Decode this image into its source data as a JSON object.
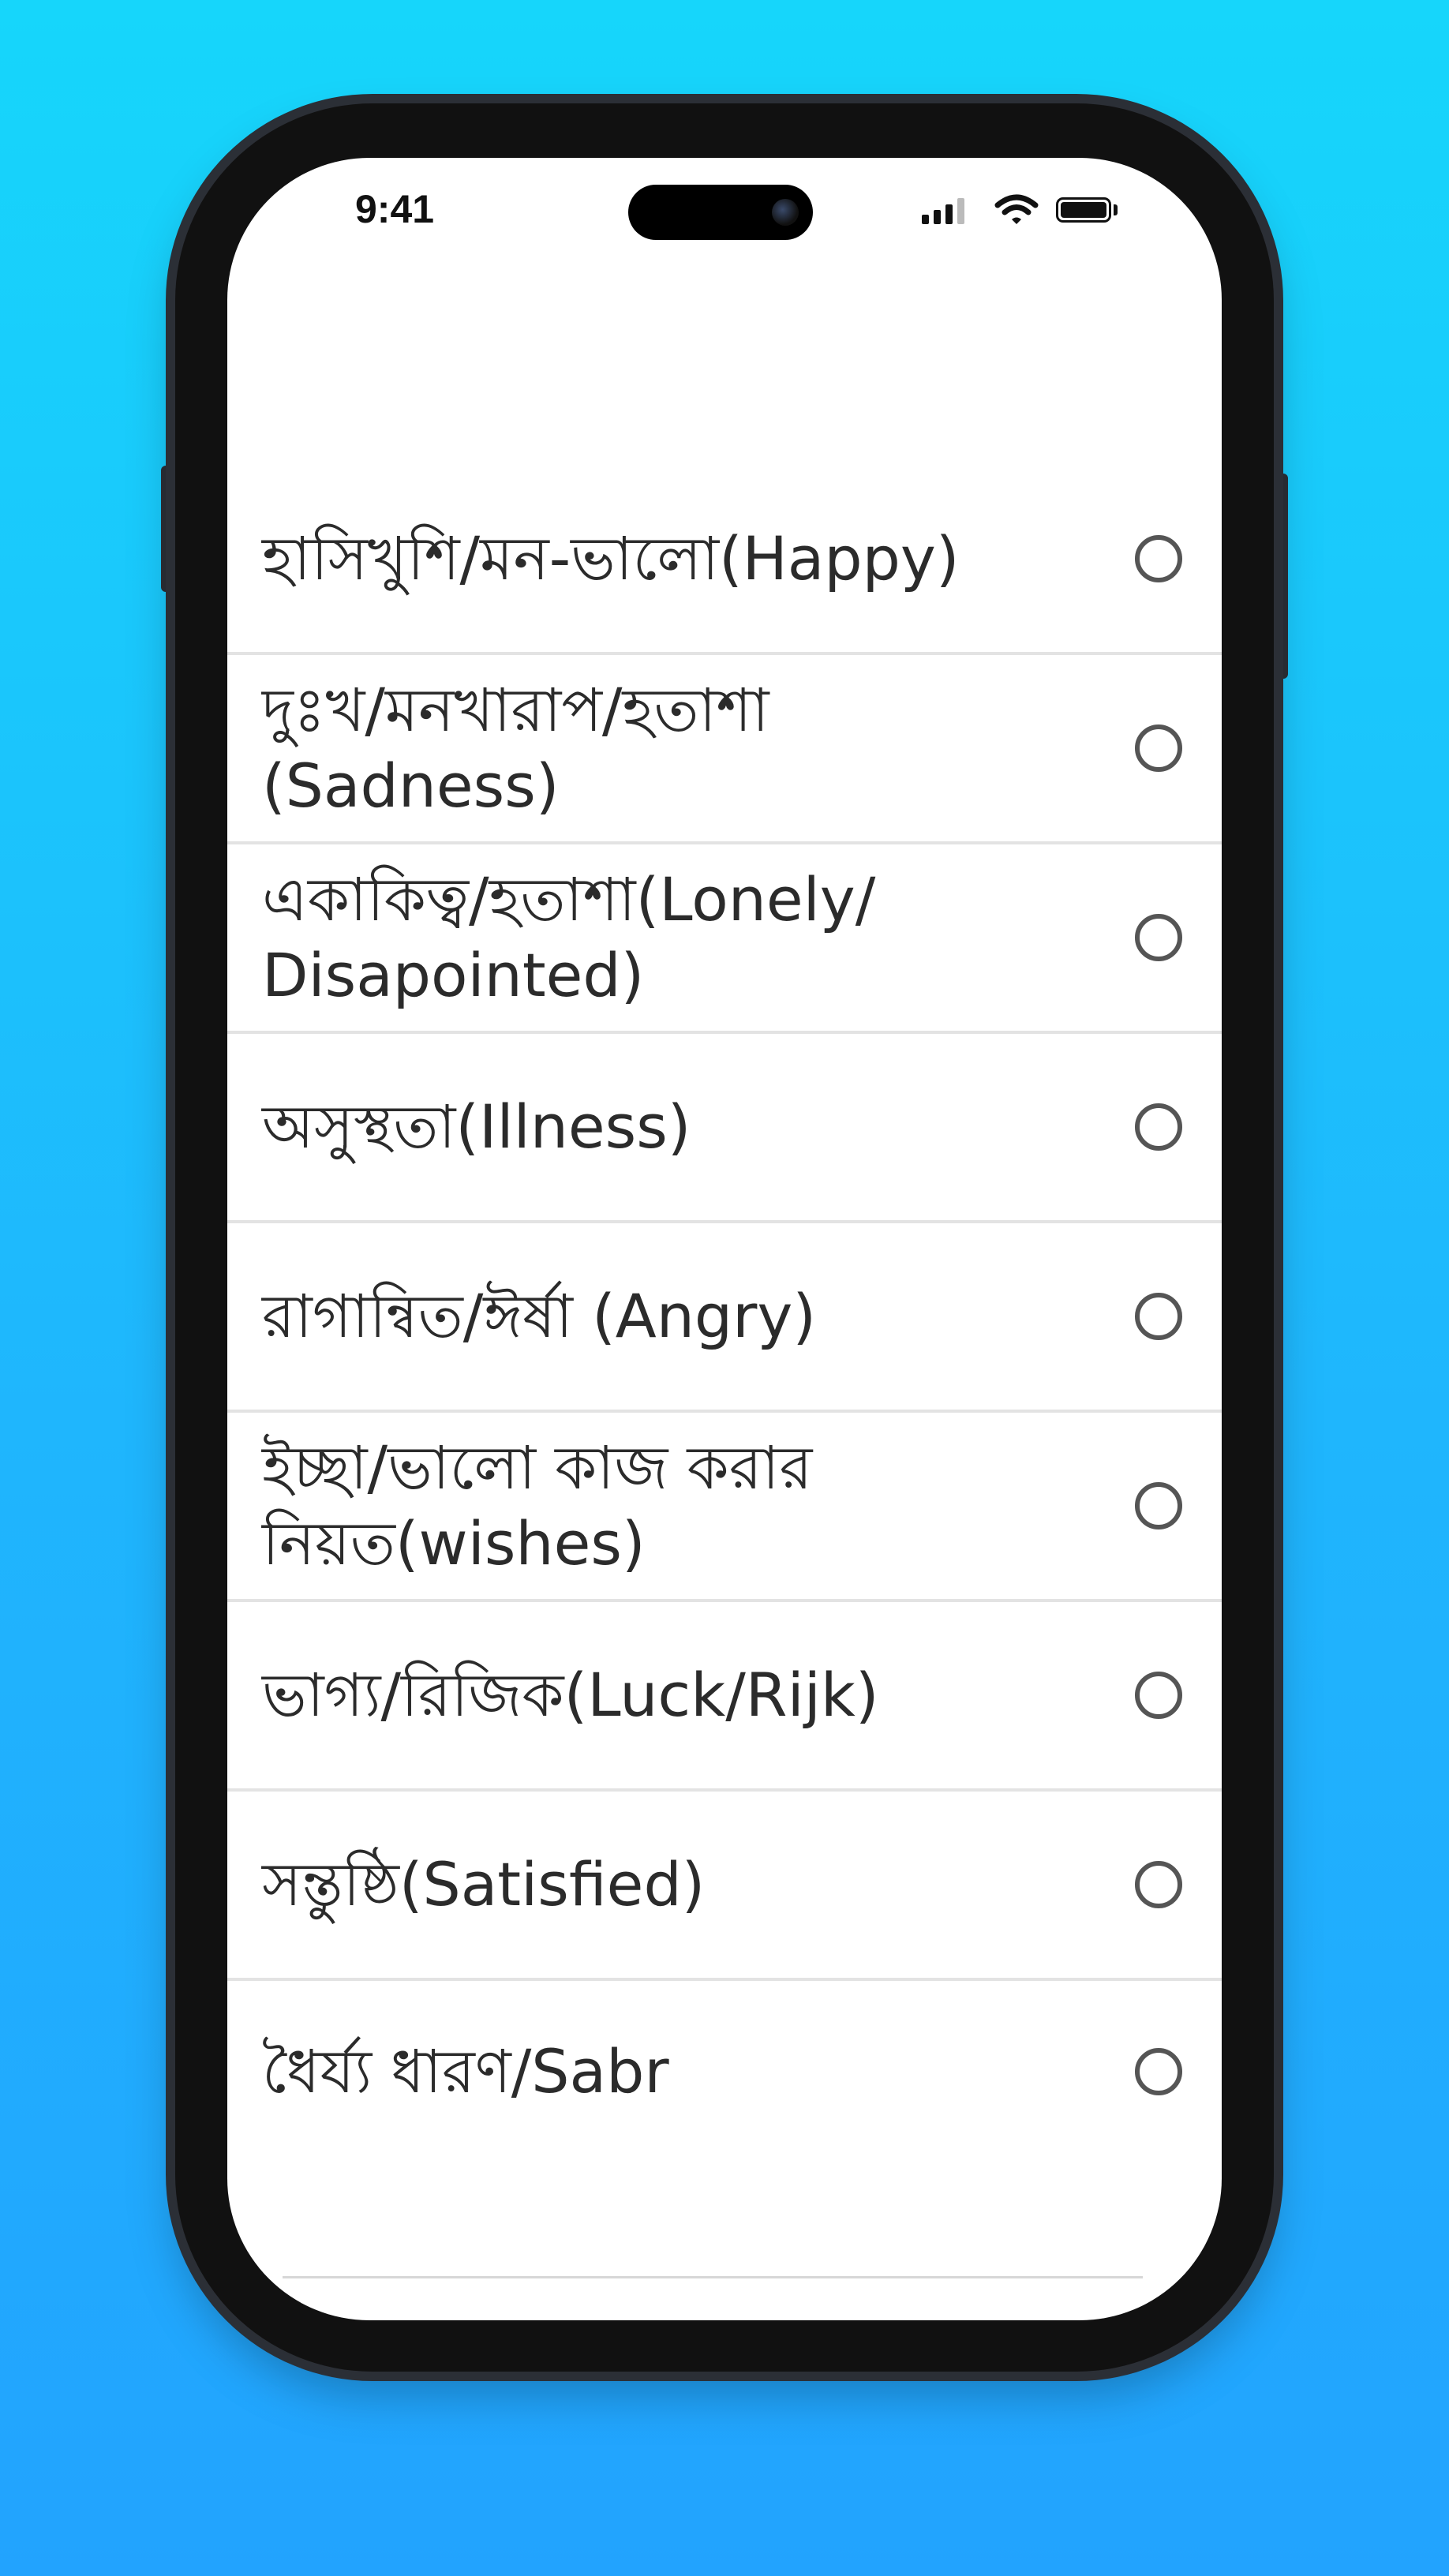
{
  "status_bar": {
    "time": "9:41",
    "icons": [
      "cellular-signal-icon",
      "wifi-icon",
      "battery-icon"
    ]
  },
  "mood_list": {
    "items": [
      {
        "label": "হাসিখুশি/মন-ভালো(Happy)",
        "selected": false
      },
      {
        "label": "দুঃখ/মনখারাপ/হতাশা\n(Sadness)",
        "selected": false
      },
      {
        "label": "একাকিত্ব/হতাশা(Lonely/\nDisapointed)",
        "selected": false
      },
      {
        "label": "অসুস্থতা(Illness)",
        "selected": false
      },
      {
        "label": "রাগান্বিত/ঈর্ষা (Angry)",
        "selected": false
      },
      {
        "label": "ইচ্ছা/ভালো কাজ করার\nনিয়ত(wishes)",
        "selected": false
      },
      {
        "label": "ভাগ্য/রিজিক(Luck/Rijk)",
        "selected": false
      },
      {
        "label": "সন্তুষ্ঠি(Satisfied)",
        "selected": false
      },
      {
        "label": "ধৈর্য্য ধারণ/Sabr",
        "selected": false
      }
    ]
  },
  "nav_bar": {
    "icons": [
      "recent-apps-icon",
      "home-icon",
      "back-icon"
    ]
  },
  "colors": {
    "background_top": "#16d6fb",
    "background_bottom": "#22a3fe",
    "phone_frame": "#111111",
    "divider": "#e3e3e3",
    "text": "#2b2b2b",
    "radio_border": "#555555"
  }
}
